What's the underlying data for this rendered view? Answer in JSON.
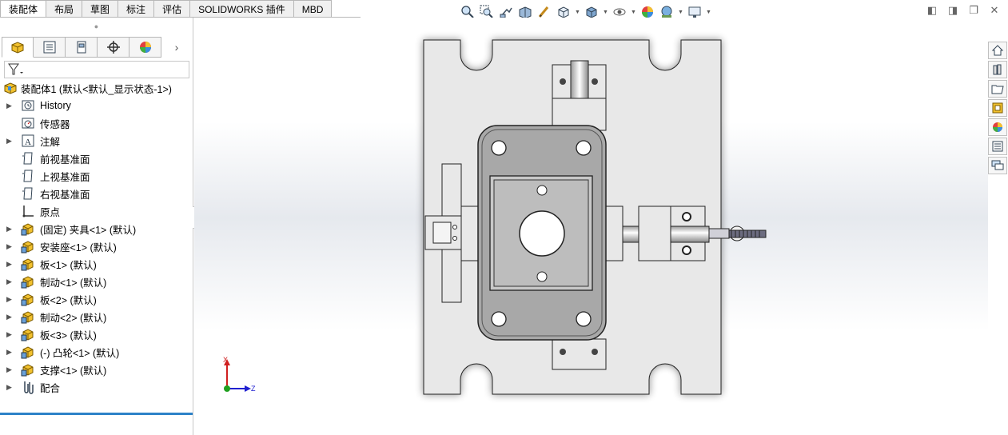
{
  "command_tabs": [
    {
      "label": "装配体",
      "active": true
    },
    {
      "label": "布局",
      "active": false
    },
    {
      "label": "草图",
      "active": false
    },
    {
      "label": "标注",
      "active": false
    },
    {
      "label": "评估",
      "active": false
    },
    {
      "label": "SOLIDWORKS 插件",
      "active": false
    },
    {
      "label": "MBD",
      "active": false
    }
  ],
  "heads_up_toolbar": [
    "zoom-to-fit-icon",
    "zoom-to-area-icon",
    "previous-view-icon",
    "section-view-icon",
    "dynamic-annotation-icon",
    "view-orientation-icon",
    "display-style-icon",
    "hide-show-items-icon",
    "edit-appearance-icon",
    "apply-scene-icon",
    "view-settings-icon"
  ],
  "window_controls": [
    "restore-left-icon",
    "restore-right-icon",
    "maximize-icon",
    "close-icon"
  ],
  "feature_manager": {
    "tabs": [
      "feature-manager-icon",
      "property-manager-icon",
      "configuration-manager-icon",
      "dimxpert-icon",
      "display-manager-icon"
    ],
    "tree": [
      {
        "label": "装配体1  (默认<默认_显示状态-1>)",
        "icon": "assembly-icon",
        "expandable": false,
        "root": true
      },
      {
        "label": "History",
        "icon": "history-icon",
        "expandable": true
      },
      {
        "label": "传感器",
        "icon": "sensor-icon",
        "expandable": false
      },
      {
        "label": "注解",
        "icon": "annotation-icon",
        "expandable": true
      },
      {
        "label": "前视基准面",
        "icon": "plane-icon",
        "expandable": false
      },
      {
        "label": "上视基准面",
        "icon": "plane-icon",
        "expandable": false
      },
      {
        "label": "右视基准面",
        "icon": "plane-icon",
        "expandable": false
      },
      {
        "label": "原点",
        "icon": "origin-icon",
        "expandable": false
      },
      {
        "label": "(固定) 夹具<1> (默认)",
        "icon": "part-icon",
        "expandable": true
      },
      {
        "label": "安装座<1> (默认)",
        "icon": "part-icon",
        "expandable": true
      },
      {
        "label": "板<1> (默认)",
        "icon": "part-icon",
        "expandable": true
      },
      {
        "label": "制动<1> (默认)",
        "icon": "part-icon",
        "expandable": true
      },
      {
        "label": "板<2> (默认)",
        "icon": "part-icon",
        "expandable": true
      },
      {
        "label": "制动<2> (默认)",
        "icon": "part-icon",
        "expandable": true
      },
      {
        "label": "板<3> (默认)",
        "icon": "part-icon",
        "expandable": true
      },
      {
        "label": "(-) 凸轮<1> (默认)",
        "icon": "part-icon",
        "expandable": true
      },
      {
        "label": "支撑<1> (默认)",
        "icon": "part-icon",
        "expandable": true
      },
      {
        "label": "配合",
        "icon": "mates-icon",
        "expandable": true
      }
    ]
  },
  "task_pane": [
    "home-icon",
    "design-library-icon",
    "file-explorer-icon",
    "view-palette-icon",
    "appearances-icon",
    "custom-properties-icon",
    "forum-icon"
  ],
  "triad": {
    "x_label": "X",
    "z_label": "Z"
  },
  "colors": {
    "accent": "#2d82c8",
    "model_fill": "#e8e8e8",
    "model_dark": "#a8a8a8",
    "axis_x": "#d02020",
    "axis_z": "#2020d0",
    "axis_y": "#20a020"
  }
}
